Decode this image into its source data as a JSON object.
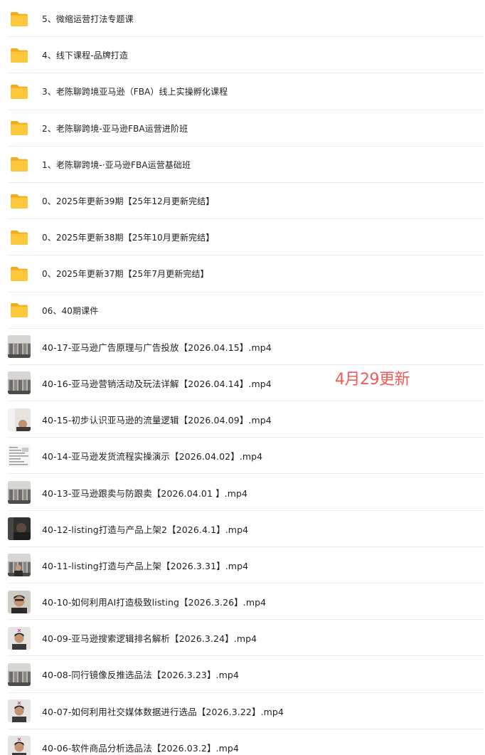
{
  "files": [
    {
      "type": "folder",
      "name": "5、微缩运营打法专题课",
      "icon": "folder-icon"
    },
    {
      "type": "folder",
      "name": "4、线下课程-品牌打造",
      "icon": "folder-icon"
    },
    {
      "type": "folder",
      "name": "3、老陈聊跨境亚马逊（FBA）线上实操孵化课程",
      "icon": "folder-icon"
    },
    {
      "type": "folder",
      "name": "2、老陈聊跨境-亚马逊FBA运营进阶班",
      "icon": "folder-icon"
    },
    {
      "type": "folder",
      "name": "1、老陈聊跨境-·亚马逊FBA运营基础班",
      "icon": "folder-icon"
    },
    {
      "type": "folder",
      "name": "0、2025年更新39期【25年12月更新完结】",
      "icon": "folder-icon"
    },
    {
      "type": "folder",
      "name": "0、2025年更新38期【25年10月更新完结】",
      "icon": "folder-icon"
    },
    {
      "type": "folder",
      "name": "0、2025年更新37期【25年7月更新完结】",
      "icon": "folder-icon"
    },
    {
      "type": "folder",
      "name": "06、40期课件",
      "icon": "folder-icon"
    },
    {
      "type": "video",
      "name": "40-17-亚马逊广告原理与广告投放【2026.04.15】.mp4",
      "icon": "video-thumbnail",
      "thumb": "room"
    },
    {
      "type": "video",
      "name": "40-16-亚马逊营销活动及玩法详解【2026.04.14】.mp4",
      "icon": "video-thumbnail",
      "thumb": "room"
    },
    {
      "type": "video",
      "name": "40-15-初步认识亚马逊的流量逻辑【2026.04.09】.mp4",
      "icon": "video-thumbnail",
      "thumb": "person-light"
    },
    {
      "type": "video",
      "name": "40-14-亚马逊发货流程实操演示【2026.04.02】.mp4",
      "icon": "video-thumbnail",
      "thumb": "screen"
    },
    {
      "type": "video",
      "name": "40-13-亚马逊跟卖与防跟卖【2026.04.01 】.mp4",
      "icon": "video-thumbnail",
      "thumb": "room"
    },
    {
      "type": "video",
      "name": "40-12-listing打造与产品上架2【2026.4.1】.mp4",
      "icon": "video-thumbnail",
      "thumb": "dark"
    },
    {
      "type": "video",
      "name": "40-11-listing打造与产品上架【2026.3.31】.mp4",
      "icon": "video-thumbnail",
      "thumb": "room-person"
    },
    {
      "type": "video",
      "name": "40-10-如何利用AI打造极致listing【2026.3.26】.mp4",
      "icon": "video-thumbnail",
      "thumb": "face"
    },
    {
      "type": "video",
      "name": "40-09-亚马逊搜索逻辑排名解析【2026.3.24】.mp4",
      "icon": "video-thumbnail",
      "thumb": "face-light"
    },
    {
      "type": "video",
      "name": "40-08-同行镜像反推选品法【2026.3.23】.mp4",
      "icon": "video-thumbnail",
      "thumb": "room"
    },
    {
      "type": "video",
      "name": "40-07-如何利用社交媒体数据进行选品【2026.3.22】.mp4",
      "icon": "video-thumbnail",
      "thumb": "face-light"
    },
    {
      "type": "video",
      "name": "40-06-软件商品分析选品法【2026.03.2】.mp4",
      "icon": "video-thumbnail",
      "thumb": "face-light"
    }
  ],
  "annotation": {
    "text": "4月29更新",
    "color": "#f05a57"
  },
  "colors": {
    "folder": "#f9c23c",
    "folder_back": "#f2ac1f",
    "divider": "#ebebeb",
    "text": "#1f1f1f"
  }
}
